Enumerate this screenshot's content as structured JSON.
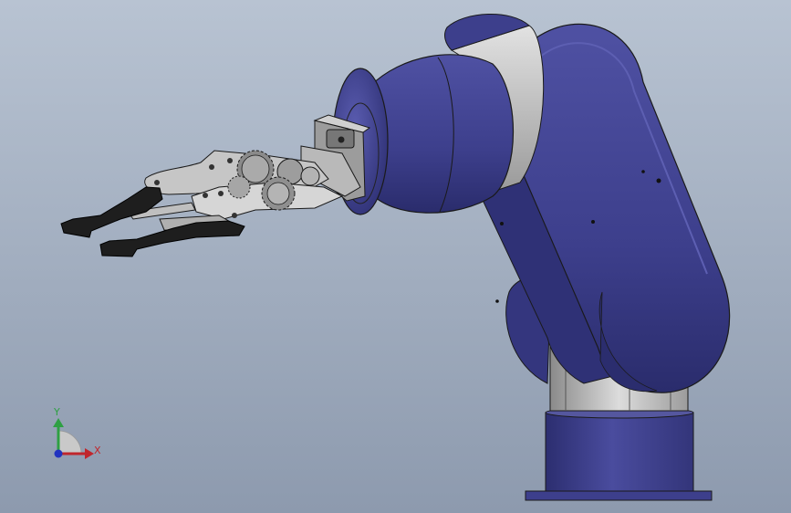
{
  "viewport": {
    "background_top": "#b8c3d2",
    "background_bottom": "#8d9aae"
  },
  "colors": {
    "arm_blue": "#3d3f8c",
    "arm_blue_dark": "#2c2e70",
    "arm_blue_light": "#5557a6",
    "metal_light": "#d4d4d4",
    "metal_mid": "#a8a8a8",
    "metal_dark": "#6e6e6e",
    "finger_black": "#1e1e1e",
    "outline": "#1a1a1a"
  },
  "triad": {
    "x_label": "X",
    "y_label": "Y",
    "x_color": "#c0262c",
    "y_color": "#2ea043",
    "z_color": "#2233c0"
  }
}
